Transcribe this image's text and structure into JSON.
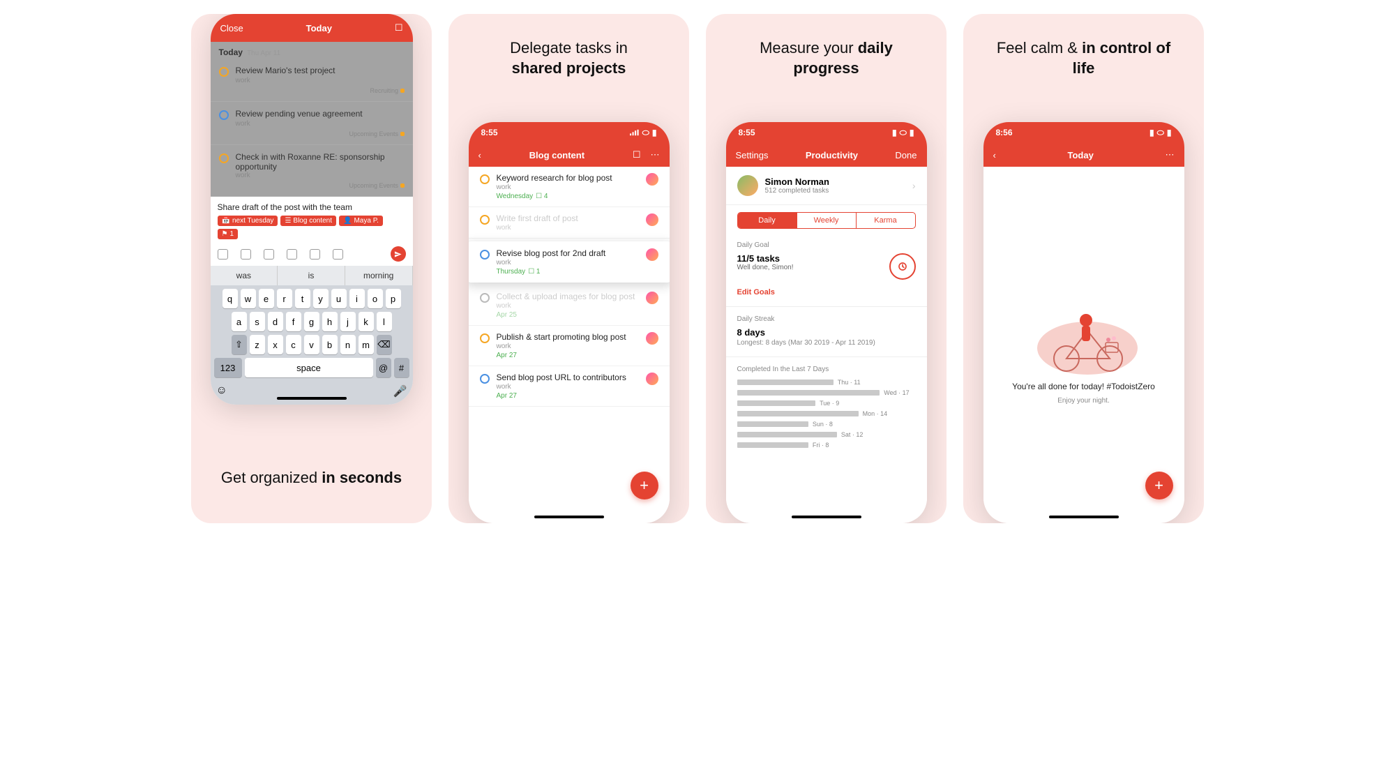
{
  "screen1": {
    "caption_pre": "Get organized ",
    "caption_bold": "in seconds",
    "header_close": "Close",
    "header_title": "Today",
    "section_date": "Today",
    "section_date_sub": "Thu Apr 11",
    "tasks": [
      {
        "title": "Review Mario's test project",
        "project": "work",
        "tag": "Recruiting"
      },
      {
        "title": "Review pending venue agreement",
        "project": "work",
        "tag": "Upcoming Events"
      },
      {
        "title": "Check in with Roxanne RE: sponsorship opportunity",
        "project": "work",
        "tag": "Upcoming Events"
      }
    ],
    "input_text": "Share draft of the post with the team",
    "pills": {
      "date": "next Tuesday",
      "project": "Blog content",
      "assignee": "Maya P.",
      "priority": "1"
    },
    "suggestions": [
      "was",
      "is",
      "morning"
    ],
    "keys_r1": [
      "q",
      "w",
      "e",
      "r",
      "t",
      "y",
      "u",
      "i",
      "o",
      "p"
    ],
    "keys_r2": [
      "a",
      "s",
      "d",
      "f",
      "g",
      "h",
      "j",
      "k",
      "l"
    ],
    "keys_r3": [
      "z",
      "x",
      "c",
      "v",
      "b",
      "n",
      "m"
    ],
    "key_123": "123",
    "key_space": "space",
    "key_at": "@",
    "key_hash": "#"
  },
  "screen2": {
    "caption_pre": "Delegate tasks in",
    "caption_bold": "shared projects",
    "status_time": "8:55",
    "title": "Blog content",
    "tasks": [
      {
        "title": "Keyword research for blog post",
        "project": "work",
        "date": "Wednesday",
        "comments": "4",
        "circle": "orange"
      },
      {
        "title": "Write first draft of post",
        "project": "work",
        "date": "",
        "circle": "orange",
        "faded": true
      },
      {
        "title": "Revise blog post for 2nd draft",
        "project": "work",
        "date": "Thursday",
        "comments": "1",
        "circle": "blue",
        "popped": true
      },
      {
        "title": "Collect & upload images for blog post",
        "project": "work",
        "date": "Apr 25",
        "circle": "grey",
        "faded": true
      },
      {
        "title": "Publish & start promoting blog post",
        "project": "work",
        "date": "Apr 27",
        "circle": "orange"
      },
      {
        "title": "Send blog post URL to contributors",
        "project": "work",
        "date": "Apr 27",
        "circle": "blue"
      }
    ]
  },
  "screen3": {
    "caption_pre": "Measure your ",
    "caption_bold": "daily progress",
    "status_time": "8:55",
    "nav_left": "Settings",
    "title": "Productivity",
    "nav_right": "Done",
    "profile_name": "Simon Norman",
    "profile_sub": "512 completed tasks",
    "seg": [
      "Daily",
      "Weekly",
      "Karma"
    ],
    "seg_active": 0,
    "goal_header": "Daily Goal",
    "goal_title": "11/5 tasks",
    "goal_sub": "Well done, Simon!",
    "edit_goals": "Edit Goals",
    "streak_header": "Daily Streak",
    "streak_title": "8 days",
    "streak_sub": "Longest: 8 days (Mar 30 2019 - Apr 11 2019)",
    "history_header": "Completed In the Last 7 Days",
    "history": [
      {
        "len": 54,
        "label": "Thu · 11"
      },
      {
        "len": 80,
        "label": "Wed · 17"
      },
      {
        "len": 44,
        "label": "Tue · 9"
      },
      {
        "len": 68,
        "label": "Mon · 14"
      },
      {
        "len": 40,
        "label": "Sun · 8"
      },
      {
        "len": 56,
        "label": "Sat · 12"
      },
      {
        "len": 40,
        "label": "Fri · 8"
      }
    ]
  },
  "screen4": {
    "caption_pre": "Feel calm & ",
    "caption_bold": "in control of life",
    "status_time": "8:56",
    "title": "Today",
    "msg1": "You're all done for today! #TodoistZero",
    "msg2": "Enjoy your night."
  }
}
